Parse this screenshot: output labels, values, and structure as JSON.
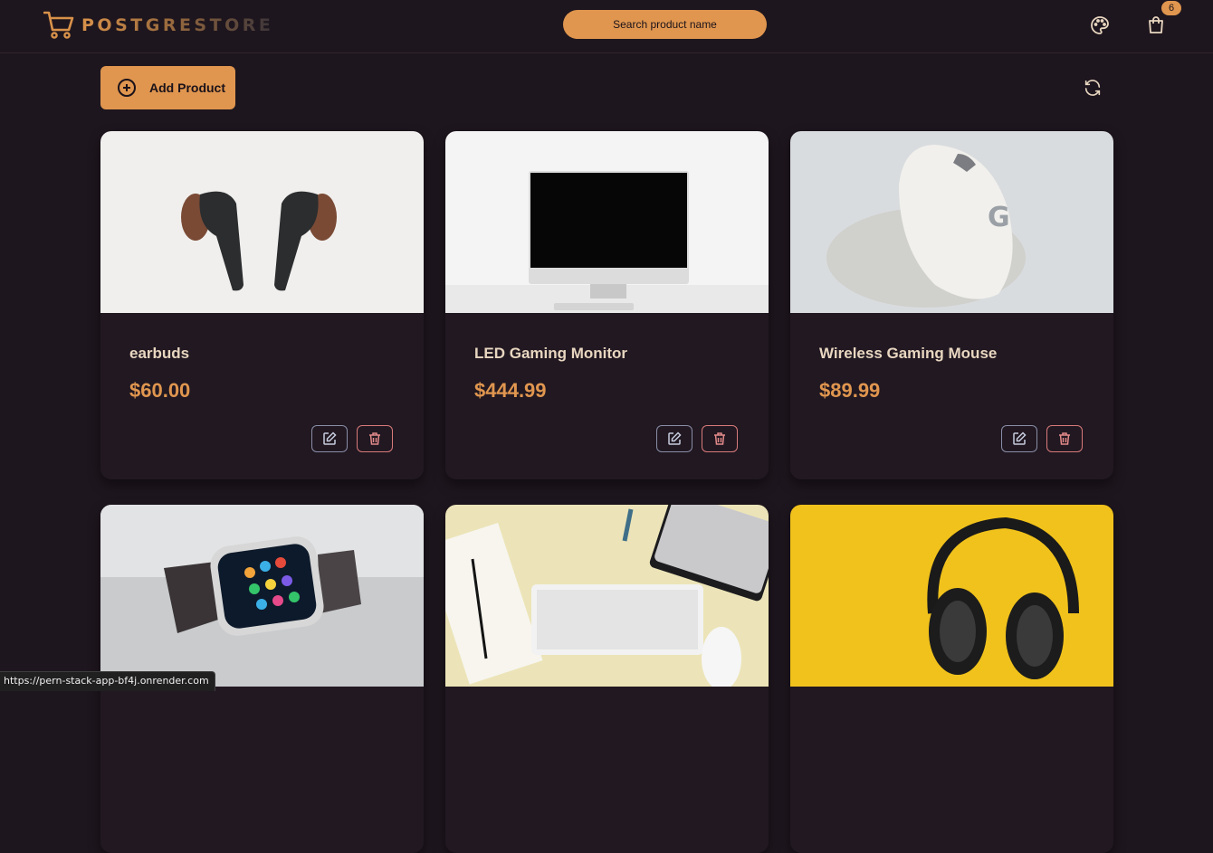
{
  "app": {
    "logo_text": "POSTGRESTORE"
  },
  "header": {
    "search_placeholder": "Search product name",
    "cart_count": "6",
    "icons": [
      "shopping-cart-icon",
      "palette-icon",
      "shopping-bag-icon"
    ]
  },
  "toolbar": {
    "add_label": "Add Product",
    "icons": [
      "plus-circle-icon",
      "refresh-icon"
    ]
  },
  "products": [
    {
      "name": "earbuds",
      "price": "$60.00",
      "image": "earbuds-photo"
    },
    {
      "name": "LED Gaming Monitor",
      "price": "$444.99",
      "image": "monitor-photo"
    },
    {
      "name": "Wireless Gaming Mouse",
      "price": "$89.99",
      "image": "mouse-photo"
    },
    {
      "image": "smartwatch-photo"
    },
    {
      "image": "keyboard-desk-photo"
    },
    {
      "image": "headphones-photo"
    }
  ],
  "status_bar": {
    "url": "https://pern-stack-app-bf4j.onrender.com"
  },
  "colors": {
    "accent": "#e0964f",
    "background": "#1e161e",
    "card": "#211821",
    "delete": "#d97a7a"
  }
}
